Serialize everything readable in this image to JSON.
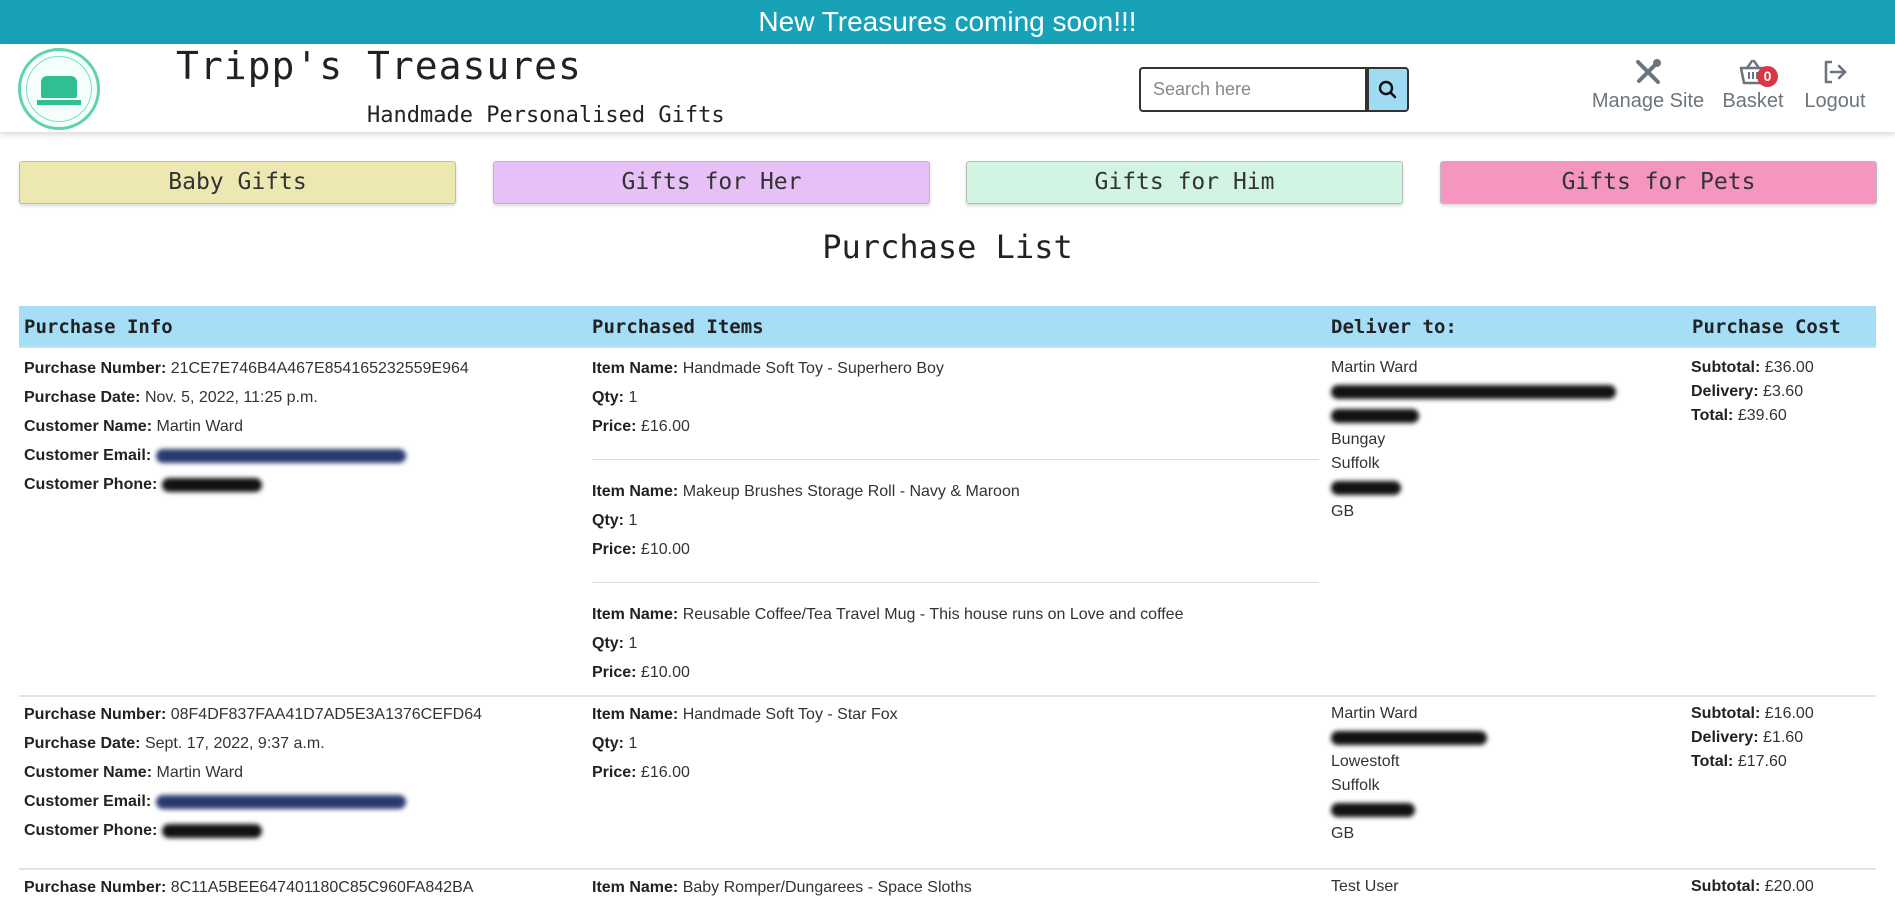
{
  "banner": {
    "text": "New Treasures coming soon!!!"
  },
  "brand": {
    "title": "Tripp's Treasures",
    "tagline": "Handmade Personalised Gifts",
    "logo_icon": "sewing-machine-logo-icon"
  },
  "search": {
    "placeholder": "Search here",
    "icon": "search-icon"
  },
  "nav": {
    "manage": {
      "label": "Manage Site",
      "icon": "tools-icon"
    },
    "basket": {
      "label": "Basket",
      "count": "0",
      "icon": "basket-icon"
    },
    "logout": {
      "label": "Logout",
      "icon": "logout-icon"
    }
  },
  "categories": [
    {
      "label": "Baby Gifts",
      "color": "#ede8b2"
    },
    {
      "label": "Gifts for Her",
      "color": "#e6c0f7"
    },
    {
      "label": "Gifts for Him",
      "color": "#d2f5e3"
    },
    {
      "label": "Gifts for Pets",
      "color": "#f496bf"
    }
  ],
  "page_title": "Purchase List",
  "table": {
    "headers": [
      "Purchase Info",
      "Purchased Items",
      "Deliver to:",
      "Purchase Cost"
    ],
    "labels": {
      "purchase_number": "Purchase Number:",
      "purchase_date": "Purchase Date:",
      "customer_name": "Customer Name:",
      "customer_email": "Customer Email:",
      "customer_phone": "Customer Phone:",
      "item_name": "Item Name:",
      "qty": "Qty:",
      "price": "Price:",
      "subtotal": "Subtotal:",
      "delivery": "Delivery:",
      "total": "Total:"
    },
    "rows": [
      {
        "purchase_number": "21CE7E746B4A467E854165232559E964",
        "purchase_date": "Nov. 5, 2022, 11:25 p.m.",
        "customer_name": "Martin Ward",
        "items": [
          {
            "name": "Handmade Soft Toy - Superhero Boy",
            "qty": "1",
            "price": "£16.00"
          },
          {
            "name": "Makeup Brushes Storage Roll - Navy & Maroon",
            "qty": "1",
            "price": "£10.00"
          },
          {
            "name": "Reusable Coffee/Tea Travel Mug - This house runs on Love and coffee",
            "qty": "1",
            "price": "£10.00"
          }
        ],
        "deliver_to": {
          "name": "Martin Ward",
          "town": "Bungay",
          "county": "Suffolk",
          "country": "GB"
        },
        "subtotal": "£36.00",
        "delivery": "£3.60",
        "total": "£39.60"
      },
      {
        "purchase_number": "08F4DF837FAA41D7AD5E3A1376CEFD64",
        "purchase_date": "Sept. 17, 2022, 9:37 a.m.",
        "customer_name": "Martin Ward",
        "items": [
          {
            "name": "Handmade Soft Toy - Star Fox",
            "qty": "1",
            "price": "£16.00"
          }
        ],
        "deliver_to": {
          "name": "Martin Ward",
          "town": "Lowestoft",
          "county": "Suffolk",
          "country": "GB"
        },
        "subtotal": "£16.00",
        "delivery": "£1.60",
        "total": "£17.60"
      },
      {
        "purchase_number": "8C11A5BEE647401180C85C960FA842BA",
        "items": [
          {
            "name": "Baby Romper/Dungarees - Space Sloths"
          }
        ],
        "deliver_to": {
          "name": "Test User"
        },
        "subtotal": "£20.00"
      }
    ]
  }
}
